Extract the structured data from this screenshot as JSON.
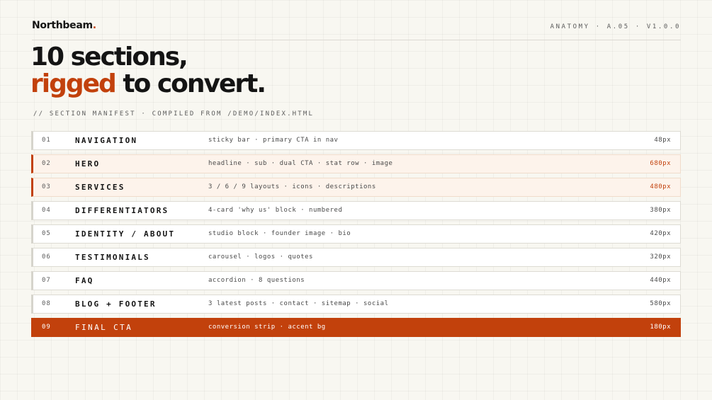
{
  "brand": {
    "name": "Northbeam",
    "dot": ".",
    "accent_color": "#c2410c"
  },
  "meta": {
    "label": "ANATOMY · A.05 · V1.0.0"
  },
  "headline": {
    "line1": "10 sections,",
    "line2_accent": "rigged",
    "line2_rest": " to convert."
  },
  "manifest": {
    "caption": "// SECTION MANIFEST · COMPILED FROM /DEMO/INDEX.HTML"
  },
  "sections": [
    {
      "num": "01",
      "name": "NAVIGATION",
      "desc": "sticky bar · primary CTA in nav",
      "size": "48px",
      "state": "default"
    },
    {
      "num": "02",
      "name": "HERO",
      "desc": "headline · sub · dual CTA · stat row · image",
      "size": "680px",
      "state": "highlight"
    },
    {
      "num": "03",
      "name": "SERVICES",
      "desc": "3 / 6 / 9 layouts · icons · descriptions",
      "size": "480px",
      "state": "highlight"
    },
    {
      "num": "04",
      "name": "DIFFERENTIATORS",
      "desc": "4-card 'why us' block · numbered",
      "size": "380px",
      "state": "default"
    },
    {
      "num": "05",
      "name": "IDENTITY / ABOUT",
      "desc": "studio block · founder image · bio",
      "size": "420px",
      "state": "default"
    },
    {
      "num": "06",
      "name": "TESTIMONIALS",
      "desc": "carousel · logos · quotes",
      "size": "320px",
      "state": "default"
    },
    {
      "num": "07",
      "name": "FAQ",
      "desc": "accordion · 8 questions",
      "size": "440px",
      "state": "default"
    },
    {
      "num": "08",
      "name": "BLOG + FOOTER",
      "desc": "3 latest posts · contact · sitemap · social",
      "size": "580px",
      "state": "default"
    },
    {
      "num": "09",
      "name": "FINAL CTA",
      "desc": "conversion strip · accent bg",
      "size": "180px",
      "state": "final"
    }
  ]
}
